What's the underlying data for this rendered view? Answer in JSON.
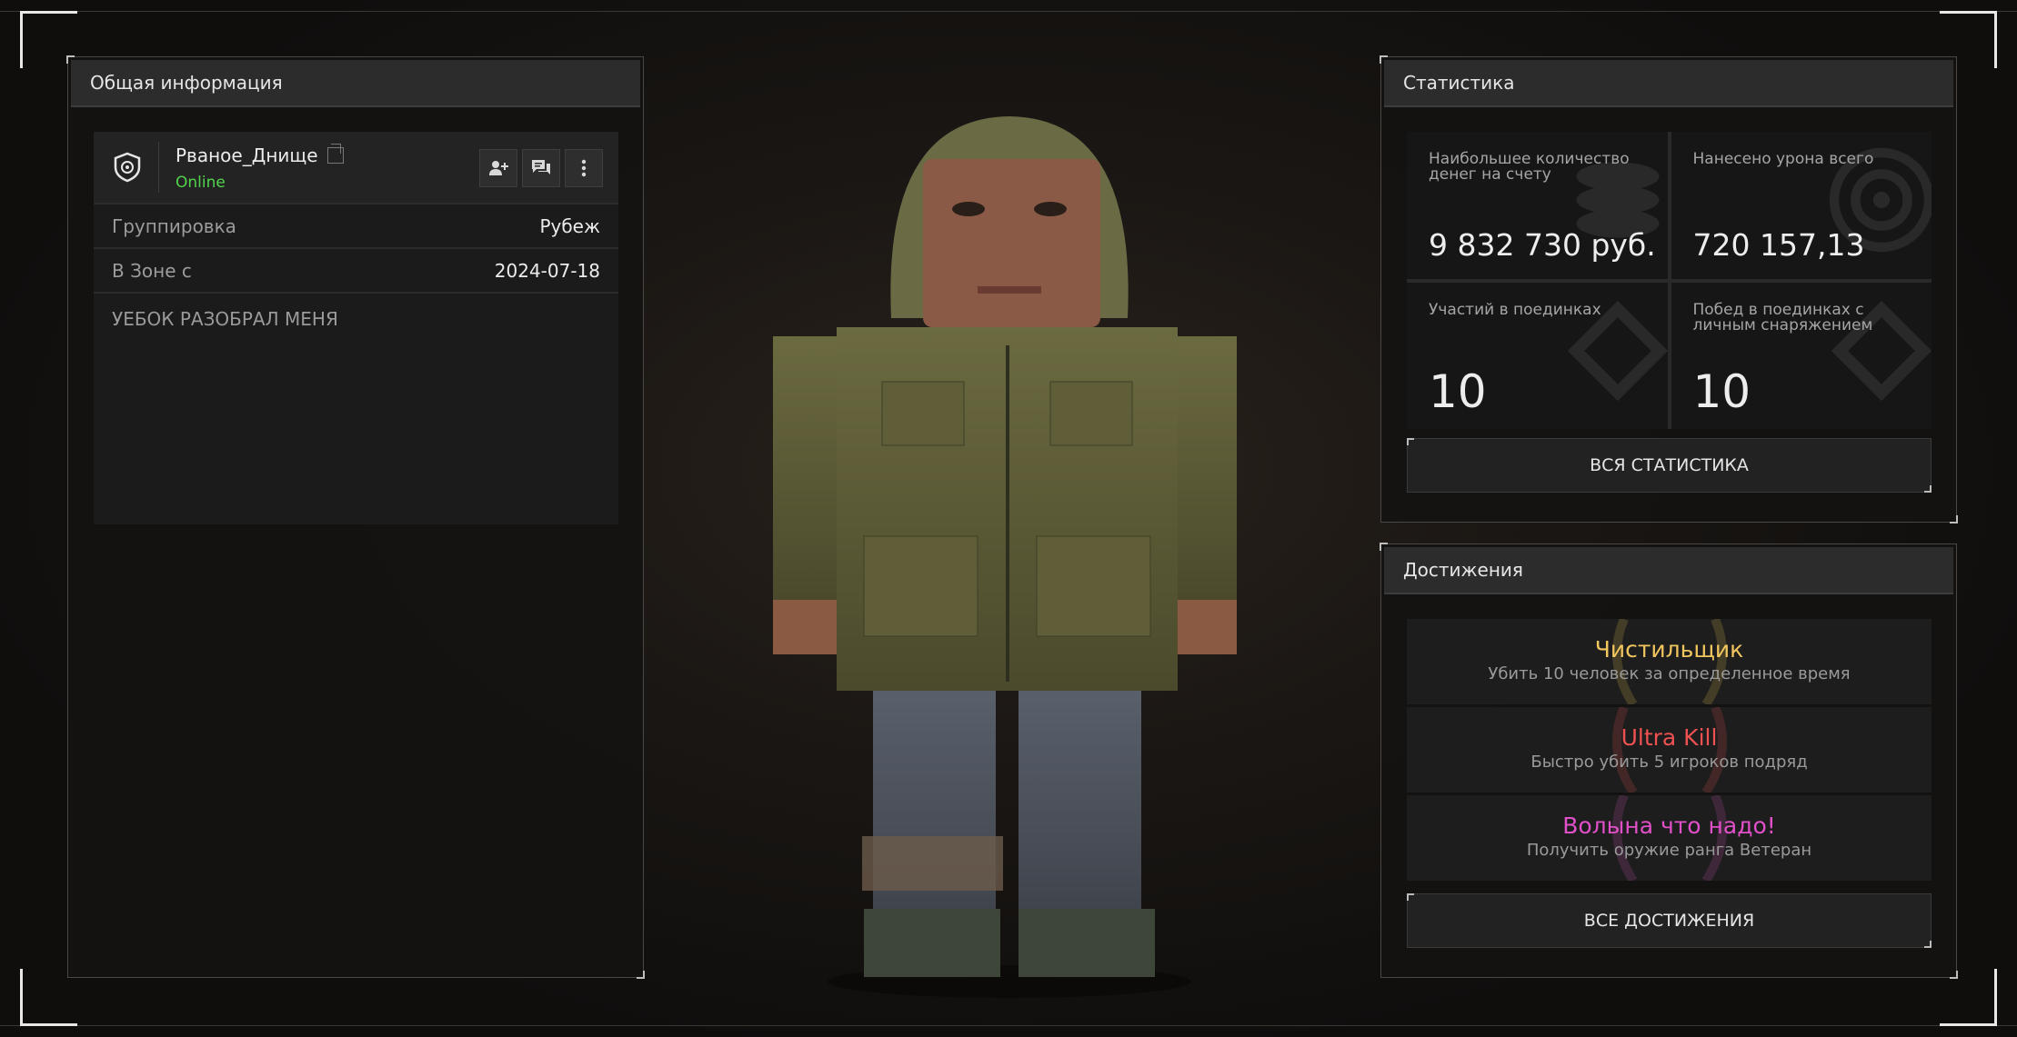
{
  "left_panel": {
    "header": "Общая информация",
    "player": {
      "name": "Рваное_Днище",
      "status": "Online"
    },
    "rows": [
      {
        "label": "Группировка",
        "value": "Рубеж"
      },
      {
        "label": "В Зоне с",
        "value": "2024-07-18"
      }
    ],
    "bio": "УЕБОК РАЗОБРАЛ МЕНЯ"
  },
  "stats_panel": {
    "header": "Статистика",
    "items": [
      {
        "label": "Наибольшее количество денег на счету",
        "value": "9 832 730 руб."
      },
      {
        "label": "Нанесено урона всего",
        "value": "720 157,13"
      },
      {
        "label": "Участий в поединках",
        "value": "10"
      },
      {
        "label": "Побед в поединках с личным снаряжением",
        "value": "10"
      }
    ],
    "button": "ВСЯ СТАТИСТИКА"
  },
  "achievements_panel": {
    "header": "Достижения",
    "items": [
      {
        "title": "Чистильщик",
        "desc": "Убить 10 человек за определенное время",
        "color": "#f2c65f"
      },
      {
        "title": "Ultra Kill",
        "desc": "Быстро убить 5 игроков подряд",
        "color": "#ef5151"
      },
      {
        "title": "Волына что надо!",
        "desc": "Получить оружие ранга Ветеран",
        "color": "#e050c8"
      }
    ],
    "button": "ВСЕ ДОСТИЖЕНИЯ"
  },
  "colors": {
    "online": "#52d34b",
    "accent_frame": "#e8e8e8"
  }
}
